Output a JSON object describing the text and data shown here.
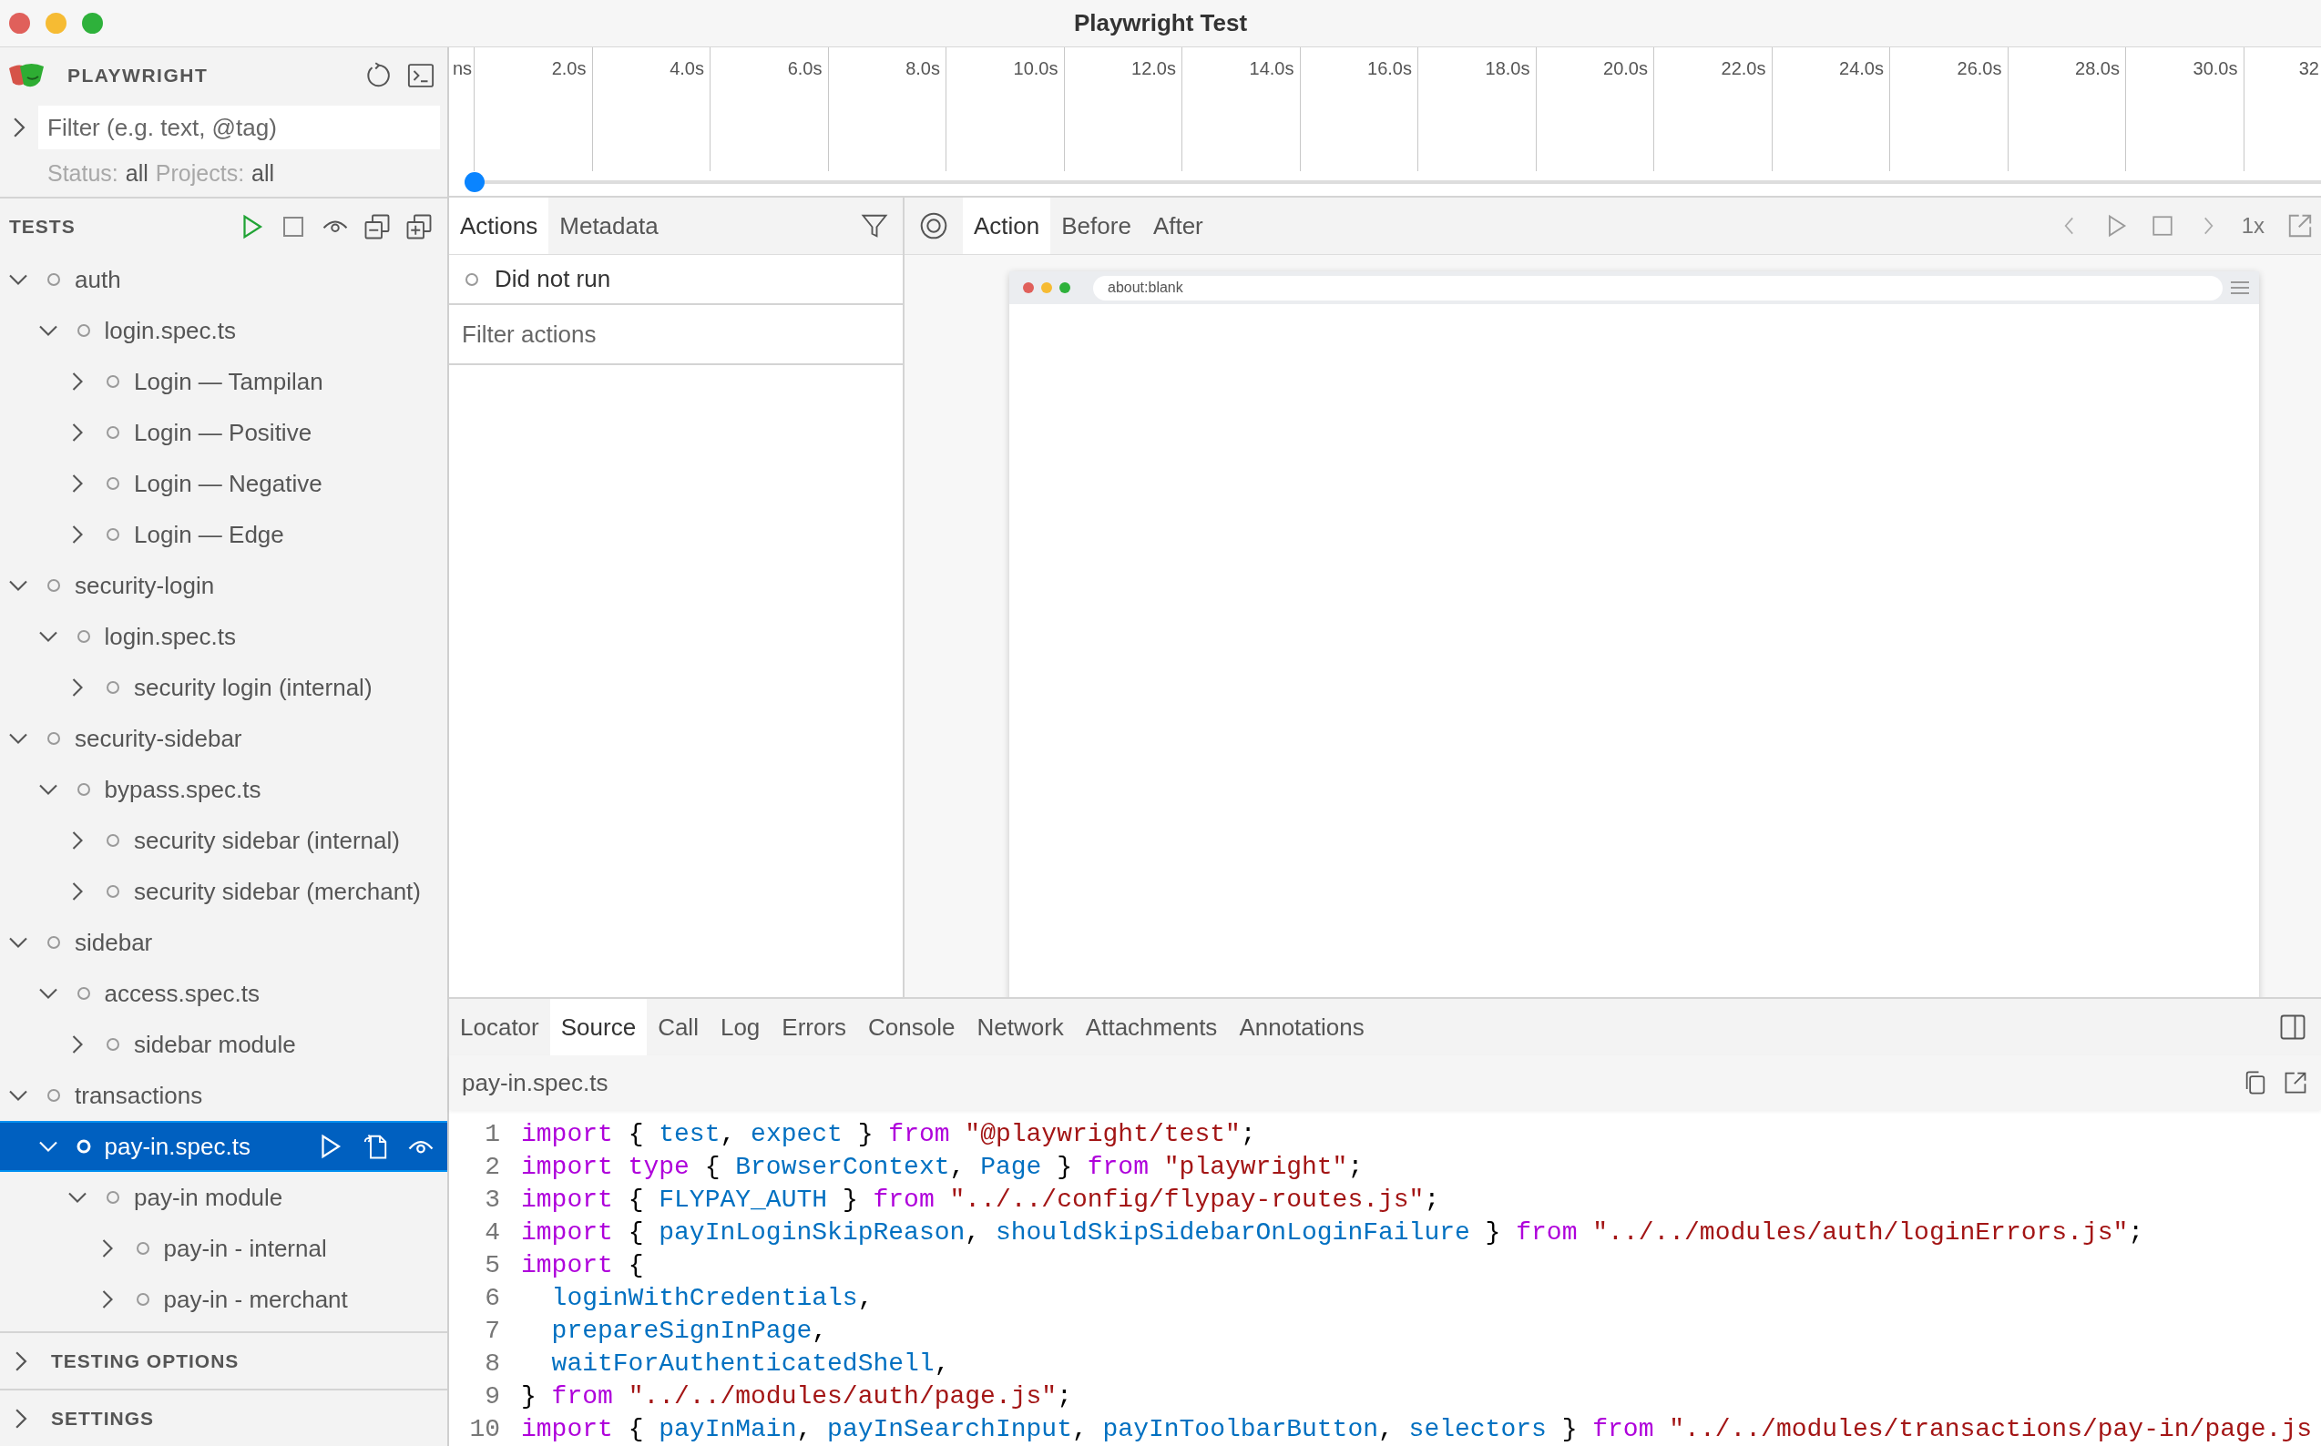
{
  "window": {
    "title": "Playwright Test"
  },
  "sidebar": {
    "app_name": "PLAYWRIGHT",
    "filter": {
      "placeholder": "Filter (e.g. text, @tag)",
      "expanded": false
    },
    "status_label": "Status:",
    "status_value": "all",
    "projects_label": "Projects:",
    "projects_value": "all",
    "tests_heading": "TESTS",
    "tree": [
      {
        "label": "auth",
        "expanded": true,
        "selected": false,
        "children": [
          {
            "label": "login.spec.ts",
            "expanded": true,
            "selected": false,
            "children": [
              {
                "label": "Login — Tampilan",
                "expanded": false,
                "selected": false
              },
              {
                "label": "Login — Positive",
                "expanded": false,
                "selected": false
              },
              {
                "label": "Login — Negative",
                "expanded": false,
                "selected": false
              },
              {
                "label": "Login — Edge",
                "expanded": false,
                "selected": false
              }
            ]
          }
        ]
      },
      {
        "label": "security-login",
        "expanded": true,
        "selected": false,
        "children": [
          {
            "label": "login.spec.ts",
            "expanded": true,
            "selected": false,
            "children": [
              {
                "label": "security login (internal)",
                "expanded": false,
                "selected": false
              }
            ]
          }
        ]
      },
      {
        "label": "security-sidebar",
        "expanded": true,
        "selected": false,
        "children": [
          {
            "label": "bypass.spec.ts",
            "expanded": true,
            "selected": false,
            "children": [
              {
                "label": "security sidebar (internal)",
                "expanded": false,
                "selected": false
              },
              {
                "label": "security sidebar (merchant)",
                "expanded": false,
                "selected": false
              }
            ]
          }
        ]
      },
      {
        "label": "sidebar",
        "expanded": true,
        "selected": false,
        "children": [
          {
            "label": "access.spec.ts",
            "expanded": true,
            "selected": false,
            "children": [
              {
                "label": "sidebar module",
                "expanded": false,
                "selected": false
              }
            ]
          }
        ]
      },
      {
        "label": "transactions",
        "expanded": true,
        "selected": false,
        "children": [
          {
            "label": "pay-in.spec.ts",
            "expanded": true,
            "selected": true,
            "children": [
              {
                "label": "pay-in module",
                "expanded": true,
                "selected": false,
                "children": [
                  {
                    "label": "pay-in - internal",
                    "expanded": false,
                    "selected": false
                  },
                  {
                    "label": "pay-in - merchant",
                    "expanded": false,
                    "selected": false
                  }
                ]
              }
            ]
          }
        ]
      }
    ],
    "sections": [
      {
        "label": "TESTING OPTIONS",
        "expanded": false
      },
      {
        "label": "SETTINGS",
        "expanded": false
      }
    ]
  },
  "timeline": {
    "labels": [
      "ns",
      "2.0s",
      "4.0s",
      "6.0s",
      "8.0s",
      "10.0s",
      "12.0s",
      "14.0s",
      "16.0s",
      "18.0s",
      "20.0s",
      "22.0s",
      "24.0s",
      "26.0s",
      "28.0s",
      "30.0s",
      "32"
    ],
    "level": 0
  },
  "actions_panel": {
    "tabs": [
      {
        "label": "Actions",
        "selected": true
      },
      {
        "label": "Metadata",
        "selected": false
      }
    ],
    "rows": [
      {
        "label": "Did not run"
      }
    ],
    "filter": {
      "placeholder": "Filter actions"
    }
  },
  "viewer": {
    "tabs": [
      {
        "label": "Action",
        "selected": true
      },
      {
        "label": "Before",
        "selected": false
      },
      {
        "label": "After",
        "selected": false
      }
    ],
    "speed": "1x",
    "browser": {
      "url": "about:blank"
    }
  },
  "details": {
    "tabs": [
      {
        "label": "Locator",
        "selected": false
      },
      {
        "label": "Source",
        "selected": true
      },
      {
        "label": "Call",
        "selected": false
      },
      {
        "label": "Log",
        "selected": false
      },
      {
        "label": "Errors",
        "selected": false
      },
      {
        "label": "Console",
        "selected": false
      },
      {
        "label": "Network",
        "selected": false
      },
      {
        "label": "Attachments",
        "selected": false
      },
      {
        "label": "Annotations",
        "selected": false
      }
    ],
    "file": "pay-in.spec.ts",
    "code": [
      {
        "number": "1",
        "tokens": [
          {
            "kind": "keyword",
            "text": "import"
          },
          {
            "kind": "plain",
            "text": " { "
          },
          {
            "kind": "name",
            "text": "test"
          },
          {
            "kind": "plain",
            "text": ", "
          },
          {
            "kind": "name",
            "text": "expect"
          },
          {
            "kind": "plain",
            "text": " } "
          },
          {
            "kind": "keyword",
            "text": "from "
          },
          {
            "kind": "string",
            "text": "\"@playwright/test\""
          },
          {
            "kind": "plain",
            "text": ";"
          }
        ]
      },
      {
        "number": "2",
        "tokens": [
          {
            "kind": "keyword",
            "text": "import type"
          },
          {
            "kind": "plain",
            "text": " { "
          },
          {
            "kind": "name",
            "text": "BrowserContext"
          },
          {
            "kind": "plain",
            "text": ", "
          },
          {
            "kind": "name",
            "text": "Page"
          },
          {
            "kind": "plain",
            "text": " } "
          },
          {
            "kind": "keyword",
            "text": "from "
          },
          {
            "kind": "string",
            "text": "\"playwright\""
          },
          {
            "kind": "plain",
            "text": ";"
          }
        ]
      },
      {
        "number": "3",
        "tokens": [
          {
            "kind": "keyword",
            "text": "import"
          },
          {
            "kind": "plain",
            "text": " { "
          },
          {
            "kind": "name",
            "text": "FLYPAY_AUTH"
          },
          {
            "kind": "plain",
            "text": " } "
          },
          {
            "kind": "keyword",
            "text": "from "
          },
          {
            "kind": "string",
            "text": "\"../../config/flypay-routes.js\""
          },
          {
            "kind": "plain",
            "text": ";"
          }
        ]
      },
      {
        "number": "4",
        "tokens": [
          {
            "kind": "keyword",
            "text": "import"
          },
          {
            "kind": "plain",
            "text": " { "
          },
          {
            "kind": "name",
            "text": "payInLoginSkipReason"
          },
          {
            "kind": "plain",
            "text": ", "
          },
          {
            "kind": "name",
            "text": "shouldSkipSidebarOnLoginFailure"
          },
          {
            "kind": "plain",
            "text": " } "
          },
          {
            "kind": "keyword",
            "text": "from "
          },
          {
            "kind": "string",
            "text": "\"../../modules/auth/loginErrors.js\""
          },
          {
            "kind": "plain",
            "text": ";"
          }
        ]
      },
      {
        "number": "5",
        "tokens": [
          {
            "kind": "keyword",
            "text": "import"
          },
          {
            "kind": "plain",
            "text": " {"
          }
        ]
      },
      {
        "number": "6",
        "tokens": [
          {
            "kind": "name",
            "text": "  loginWithCredentials"
          },
          {
            "kind": "plain",
            "text": ","
          }
        ]
      },
      {
        "number": "7",
        "tokens": [
          {
            "kind": "name",
            "text": "  prepareSignInPage"
          },
          {
            "kind": "plain",
            "text": ","
          }
        ]
      },
      {
        "number": "8",
        "tokens": [
          {
            "kind": "name",
            "text": "  waitForAuthenticatedShell"
          },
          {
            "kind": "plain",
            "text": ","
          }
        ]
      },
      {
        "number": "9",
        "tokens": [
          {
            "kind": "plain",
            "text": "} "
          },
          {
            "kind": "keyword",
            "text": "from "
          },
          {
            "kind": "string",
            "text": "\"../../modules/auth/page.js\""
          },
          {
            "kind": "plain",
            "text": ";"
          }
        ]
      },
      {
        "number": "10",
        "tokens": [
          {
            "kind": "keyword",
            "text": "import"
          },
          {
            "kind": "plain",
            "text": " { "
          },
          {
            "kind": "name",
            "text": "payInMain"
          },
          {
            "kind": "plain",
            "text": ", "
          },
          {
            "kind": "name",
            "text": "payInSearchInput"
          },
          {
            "kind": "plain",
            "text": ", "
          },
          {
            "kind": "name",
            "text": "payInToolbarButton"
          },
          {
            "kind": "plain",
            "text": ", "
          },
          {
            "kind": "name",
            "text": "selectors"
          },
          {
            "kind": "plain",
            "text": " } "
          },
          {
            "kind": "keyword",
            "text": "from "
          },
          {
            "kind": "string",
            "text": "\"../../modules/transactions/pay-in/page.js"
          }
        ]
      }
    ]
  }
}
